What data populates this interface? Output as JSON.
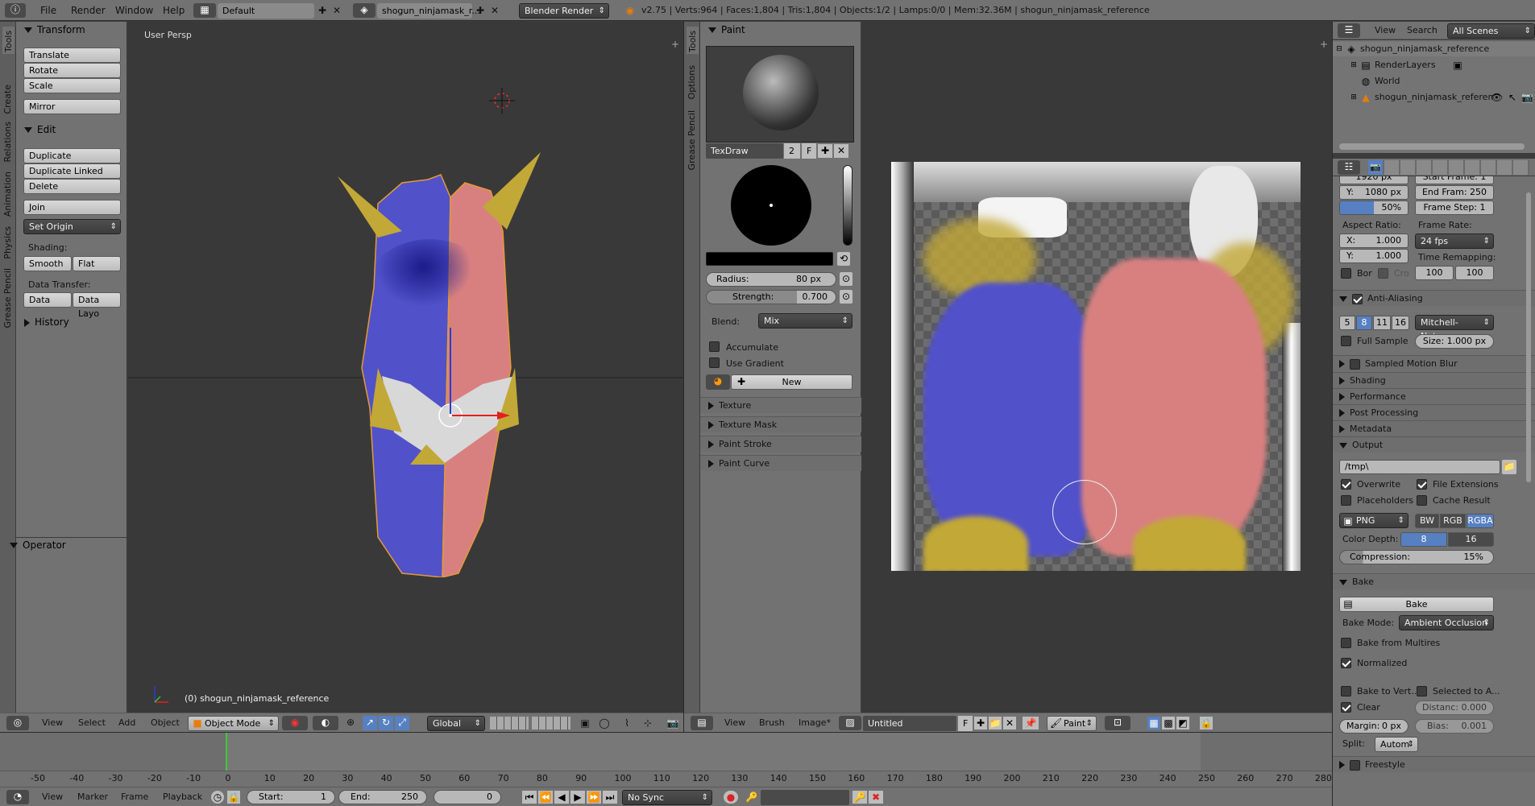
{
  "topbar": {
    "menus": [
      "File",
      "Render",
      "Window",
      "Help"
    ],
    "layout": "Default",
    "scene": "shogun_ninjamask_r...",
    "engine": "Blender Render",
    "stats": "v2.75 | Verts:964 | Faces:1,804 | Tris:1,804 | Objects:1/2 | Lamps:0/0 | Mem:32.36M | shogun_ninjamask_reference"
  },
  "toolshelf": {
    "tabs": [
      "Tools",
      "Create",
      "Relations",
      "Animation",
      "Physics",
      "Grease Pencil"
    ],
    "transform_title": "Transform",
    "transform": [
      "Translate",
      "Rotate",
      "Scale",
      "Mirror"
    ],
    "edit_title": "Edit",
    "edit": [
      "Duplicate",
      "Duplicate Linked",
      "Delete",
      "Join",
      "Set Origin"
    ],
    "shading_label": "Shading:",
    "smooth": "Smooth",
    "flat": "Flat",
    "data_transfer_label": "Data Transfer:",
    "data": "Data",
    "data_layo": "Data Layo",
    "history": "History",
    "operator": "Operator"
  },
  "viewport": {
    "label": "User Persp",
    "object_label": "(0) shogun_ninjamask_reference",
    "header": {
      "menus": [
        "View",
        "Select",
        "Add",
        "Object"
      ],
      "mode": "Object Mode",
      "orientation": "Global"
    }
  },
  "paint": {
    "tabs": [
      "Tools",
      "Options",
      "Grease Pencil"
    ],
    "title": "Paint",
    "brush_name": "TexDraw",
    "brush_users": "2",
    "fake": "F",
    "radius_label": "Radius:",
    "radius_value": "80 px",
    "strength_label": "Strength:",
    "strength_value": "0.700",
    "blend_label": "Blend:",
    "blend_value": "Mix",
    "accumulate": "Accumulate",
    "use_gradient": "Use Gradient",
    "new": "New",
    "sections": [
      "Texture",
      "Texture Mask",
      "Paint Stroke",
      "Paint Curve"
    ]
  },
  "image_editor": {
    "header": {
      "menus": [
        "View",
        "Brush",
        "Image*"
      ],
      "image_name": "Untitled",
      "fake": "F",
      "mode": "Paint"
    }
  },
  "outliner": {
    "menus": [
      "View",
      "Search"
    ],
    "filter": "All Scenes",
    "items": [
      "shogun_ninjamask_reference",
      "RenderLayers",
      "World",
      "shogun_ninjamask_referen"
    ]
  },
  "properties": {
    "res_x": "1920 px",
    "res_y_label": "Y:",
    "res_y": "1080 px",
    "res_pct": "50%",
    "start_frame": "Start Frame: 1",
    "end_frame": "End Fram: 250",
    "frame_step": "Frame Step: 1",
    "aspect_label": "Aspect Ratio:",
    "aspect_x_label": "X:",
    "aspect_x": "1.000",
    "aspect_y_label": "Y:",
    "aspect_y": "1.000",
    "frame_rate_label": "Frame Rate:",
    "frame_rate": "24 fps",
    "time_remap_label": "Time Remapping:",
    "remap_old": "100",
    "remap_new": "100",
    "bor": "Bor",
    "cro": "Cro",
    "aa_title": "Anti-Aliasing",
    "aa_samples": [
      "5",
      "8",
      "11",
      "16"
    ],
    "aa_filter": "Mitchell-Netrav...",
    "full_sample": "Full Sample",
    "filter_size": "Size: 1.000 px",
    "sections": [
      "Sampled Motion Blur",
      "Shading",
      "Performance",
      "Post Processing",
      "Metadata"
    ],
    "output_title": "Output",
    "output_path": "/tmp\\",
    "overwrite": "Overwrite",
    "file_extensions": "File Extensions",
    "placeholders": "Placeholders",
    "cache_result": "Cache Result",
    "format": "PNG",
    "color_modes": [
      "BW",
      "RGB",
      "RGBA"
    ],
    "color_depth_label": "Color Depth:",
    "depth_8": "8",
    "depth_16": "16",
    "compression": "Compression:",
    "compression_value": "15%",
    "bake_title": "Bake",
    "bake_button": "Bake",
    "bake_mode_label": "Bake Mode:",
    "bake_mode": "Ambient Occlusion",
    "bake_from_multires": "Bake from Multires",
    "normalized": "Normalized",
    "bake_to_vert": "Bake to Vert...",
    "selected_to_a": "Selected to A...",
    "clear": "Clear",
    "distance": "Distanc: 0.000",
    "margin": "Margin:",
    "margin_value": "0 px",
    "bias": "Bias:",
    "bias_value": "0.001",
    "split_label": "Split:",
    "split_value": "Autom",
    "freestyle": "Freestyle"
  },
  "timeline": {
    "ticks": [
      "-50",
      "-40",
      "-30",
      "-20",
      "-10",
      "0",
      "10",
      "20",
      "30",
      "40",
      "50",
      "60",
      "70",
      "80",
      "90",
      "100",
      "110",
      "120",
      "130",
      "140",
      "150",
      "160",
      "170",
      "180",
      "190",
      "200",
      "210",
      "220",
      "230",
      "240",
      "250",
      "260",
      "270",
      "280"
    ],
    "menus": [
      "View",
      "Marker",
      "Frame",
      "Playback"
    ],
    "start_label": "Start:",
    "start": "1",
    "end_label": "End:",
    "end": "250",
    "current": "0",
    "sync": "No Sync"
  }
}
